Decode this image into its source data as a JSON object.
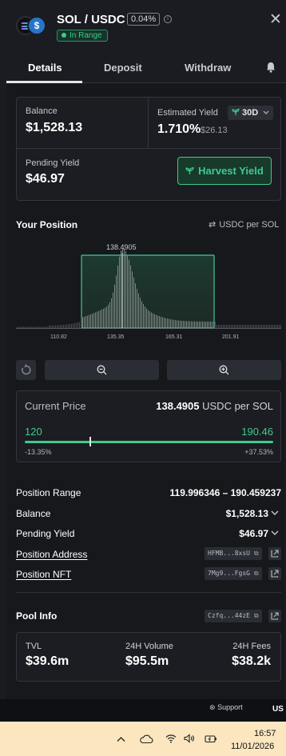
{
  "header": {
    "pair": "SOL / USDC",
    "fee": "0.04%",
    "status": "In Range",
    "close_symbol": "✕"
  },
  "tabs": [
    "Details",
    "Deposit",
    "Withdraw"
  ],
  "summary": {
    "balance_label": "Balance",
    "balance": "$1,528.13",
    "yield_label": "Estimated Yield",
    "yield_period": "30D",
    "yield_pct": "1.710%",
    "yield_usd": "$26.13",
    "pending_label": "Pending Yield",
    "pending": "$46.97",
    "harvest_label": "Harvest Yield"
  },
  "position": {
    "title": "Your Position",
    "unit_toggle": "USDC per SOL",
    "current_marker": "138.4905",
    "ticks": [
      "110.82",
      "135.35",
      "165.31",
      "201.91"
    ]
  },
  "price": {
    "label": "Current Price",
    "value": "138.4905",
    "unit": "USDC per SOL",
    "min": "120",
    "max": "190.46",
    "min_pct": "-13.35%",
    "max_pct": "+37.53%"
  },
  "rows": {
    "range_label": "Position Range",
    "range_value": "119.996346 – 190.459237",
    "balance_label": "Balance",
    "balance_value": "$1,528.13",
    "pending_label": "Pending Yield",
    "pending_value": "$46.97",
    "address_label": "Position Address",
    "address_value": "HFMB...8xsU",
    "nft_label": "Position NFT",
    "nft_value": "7Mg9...FgsG"
  },
  "pool": {
    "title": "Pool Info",
    "address": "Czfq...44zE",
    "tvl_label": "TVL",
    "tvl": "$39.6m",
    "volume_label": "24H Volume",
    "volume": "$95.5m",
    "fees_label": "24H Fees",
    "fees": "$38.2k"
  },
  "footer": {
    "support": "Support",
    "lang": "US"
  },
  "taskbar": {
    "time": "16:57",
    "date": "11/01/2026"
  },
  "colors": {
    "accent": "#3fca8e",
    "background": "#1a1c22",
    "card": "#1b1d22"
  }
}
